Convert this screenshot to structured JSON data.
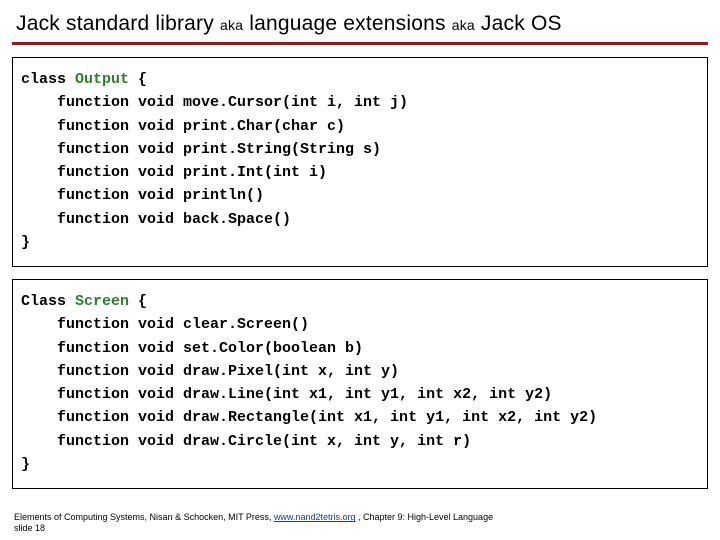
{
  "title": {
    "part1": "Jack standard library ",
    "aka1": "aka",
    "part2": " language extensions ",
    "aka2": "aka",
    "part3": " Jack OS"
  },
  "box1": {
    "line0_k": "class ",
    "line0_n": "Output ",
    "line0_r": "{",
    "l1": "    function void move.Cursor(int i, int j)",
    "l2": "    function void print.Char(char c)",
    "l3": "    function void print.String(String s)",
    "l4": "    function void print.Int(int i)",
    "l5": "    function void println()",
    "l6": "    function void back.Space()",
    "close": "}"
  },
  "box2": {
    "line0_k": "Class ",
    "line0_n": "Screen ",
    "line0_r": "{",
    "l1": "    function void clear.Screen()",
    "l2": "    function void set.Color(boolean b)",
    "l3": "    function void draw.Pixel(int x, int y)",
    "l4": "    function void draw.Line(int x1, int y1, int x2, int y2)",
    "l5": "    function void draw.Rectangle(int x1, int y1, int x2, int y2)",
    "l6": "    function void draw.Circle(int x, int y, int r)",
    "close": "}"
  },
  "footer": {
    "before_link": "Elements of Computing Systems, Nisan & Schocken, MIT Press, ",
    "link_text": "www.nand2tetris.org",
    "after_link": " , Chapter 9: High-Level Language",
    "line2": "slide 18"
  }
}
